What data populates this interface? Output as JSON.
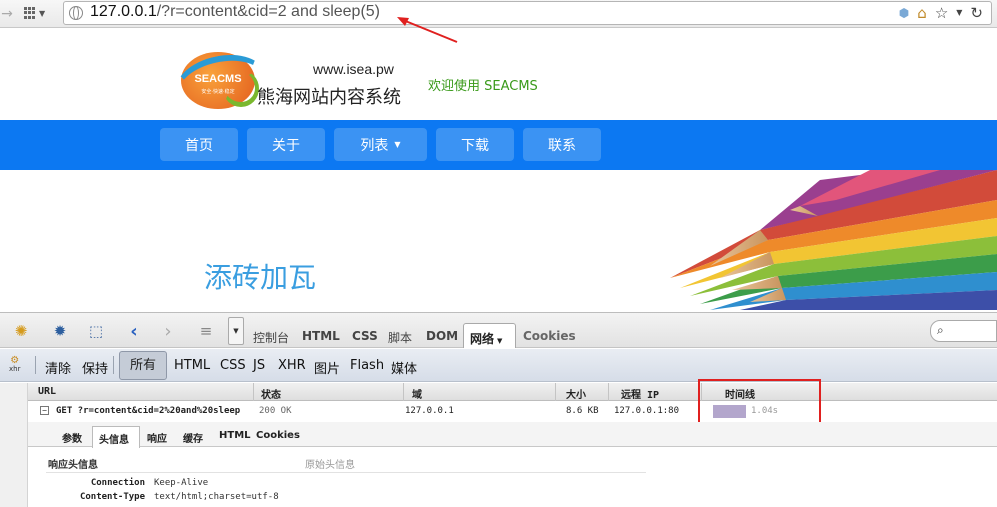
{
  "browser": {
    "url_host": "127.0.0.1",
    "url_rest": "/?r=content&cid=2 and sleep(5)"
  },
  "site": {
    "logo_text": "SEACMS",
    "logo_sub": "安全·快速·稳定",
    "domain": "www.isea.pw",
    "title": "熊海网站内容系统",
    "welcome": "欢迎使用 SEACMS",
    "nav": [
      {
        "label": "首页"
      },
      {
        "label": "关于"
      },
      {
        "label": "列表"
      },
      {
        "label": "下载"
      },
      {
        "label": "联系"
      }
    ],
    "slogan": "添砖加瓦"
  },
  "devtools": {
    "tabs": [
      "控制台",
      "HTML",
      "CSS",
      "脚本",
      "DOM",
      "网络",
      "Cookies"
    ],
    "active_tab": "网络",
    "filter": {
      "xhr_icon_label": "xhr",
      "clear": "清除",
      "persist": "保持",
      "all": "所有",
      "types": [
        "HTML",
        "CSS",
        "JS",
        "XHR",
        "图片",
        "Flash",
        "媒体"
      ]
    },
    "columns": [
      "URL",
      "状态",
      "域",
      "大小",
      "远程 IP",
      "时间线"
    ],
    "request": {
      "url": "GET ?r=content&cid=2%20and%20sleep",
      "status": "200 OK",
      "domain": "127.0.0.1",
      "size": "8.6 KB",
      "remote_ip": "127.0.0.1:80",
      "timeline": "1.04s"
    },
    "detail_tabs": [
      "参数",
      "头信息",
      "响应",
      "缓存",
      "HTML",
      "Cookies"
    ],
    "active_detail_tab": "头信息",
    "response_headers_title": "响应头信息",
    "raw_headers_link": "原始头信息",
    "headers": [
      {
        "name": "Connection",
        "value": "Keep-Alive"
      },
      {
        "name": "Content-Type",
        "value": "text/html;charset=utf-8"
      }
    ]
  }
}
